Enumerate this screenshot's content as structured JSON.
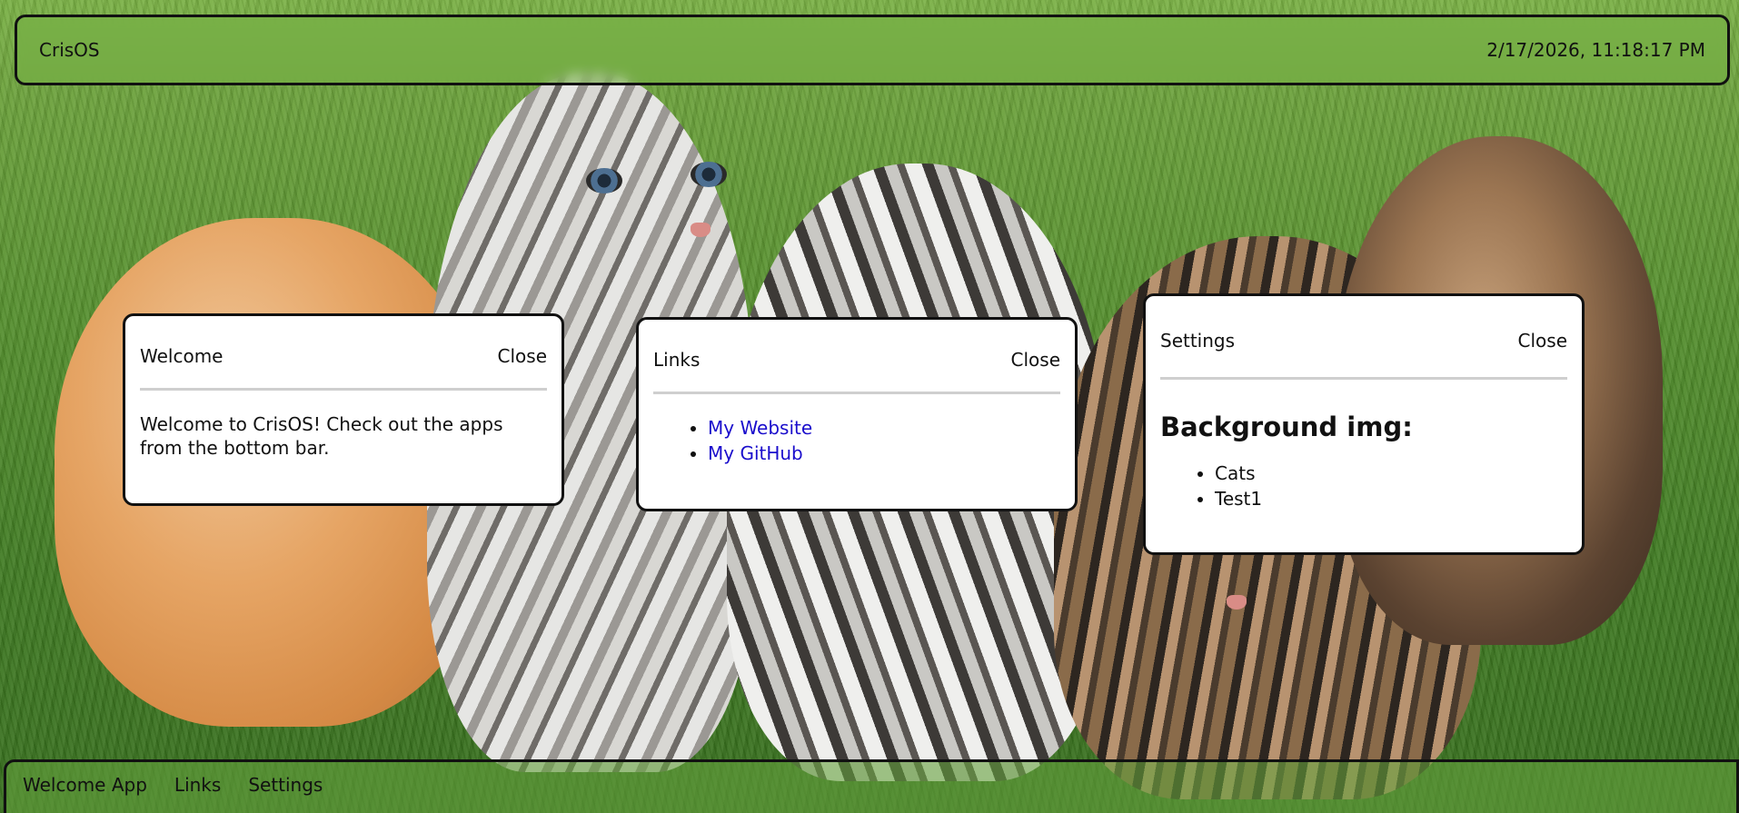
{
  "topbar": {
    "os_name": "CrisOS",
    "clock": "2/17/2026, 11:18:17 PM"
  },
  "windows": {
    "welcome": {
      "title": "Welcome",
      "close_label": "Close",
      "message": "Welcome to CrisOS! Check out the apps from the bottom bar."
    },
    "links": {
      "title": "Links",
      "close_label": "Close",
      "items": [
        "My Website",
        "My GitHub"
      ]
    },
    "settings": {
      "title": "Settings",
      "close_label": "Close",
      "heading": "Background img:",
      "options": [
        "Cats",
        "Test1"
      ]
    }
  },
  "taskbar": {
    "items": [
      "Welcome App",
      "Links",
      "Settings"
    ]
  },
  "colors": {
    "link": "#1a0dcc",
    "window_border": "#111111",
    "divider": "#cfcfcf"
  }
}
